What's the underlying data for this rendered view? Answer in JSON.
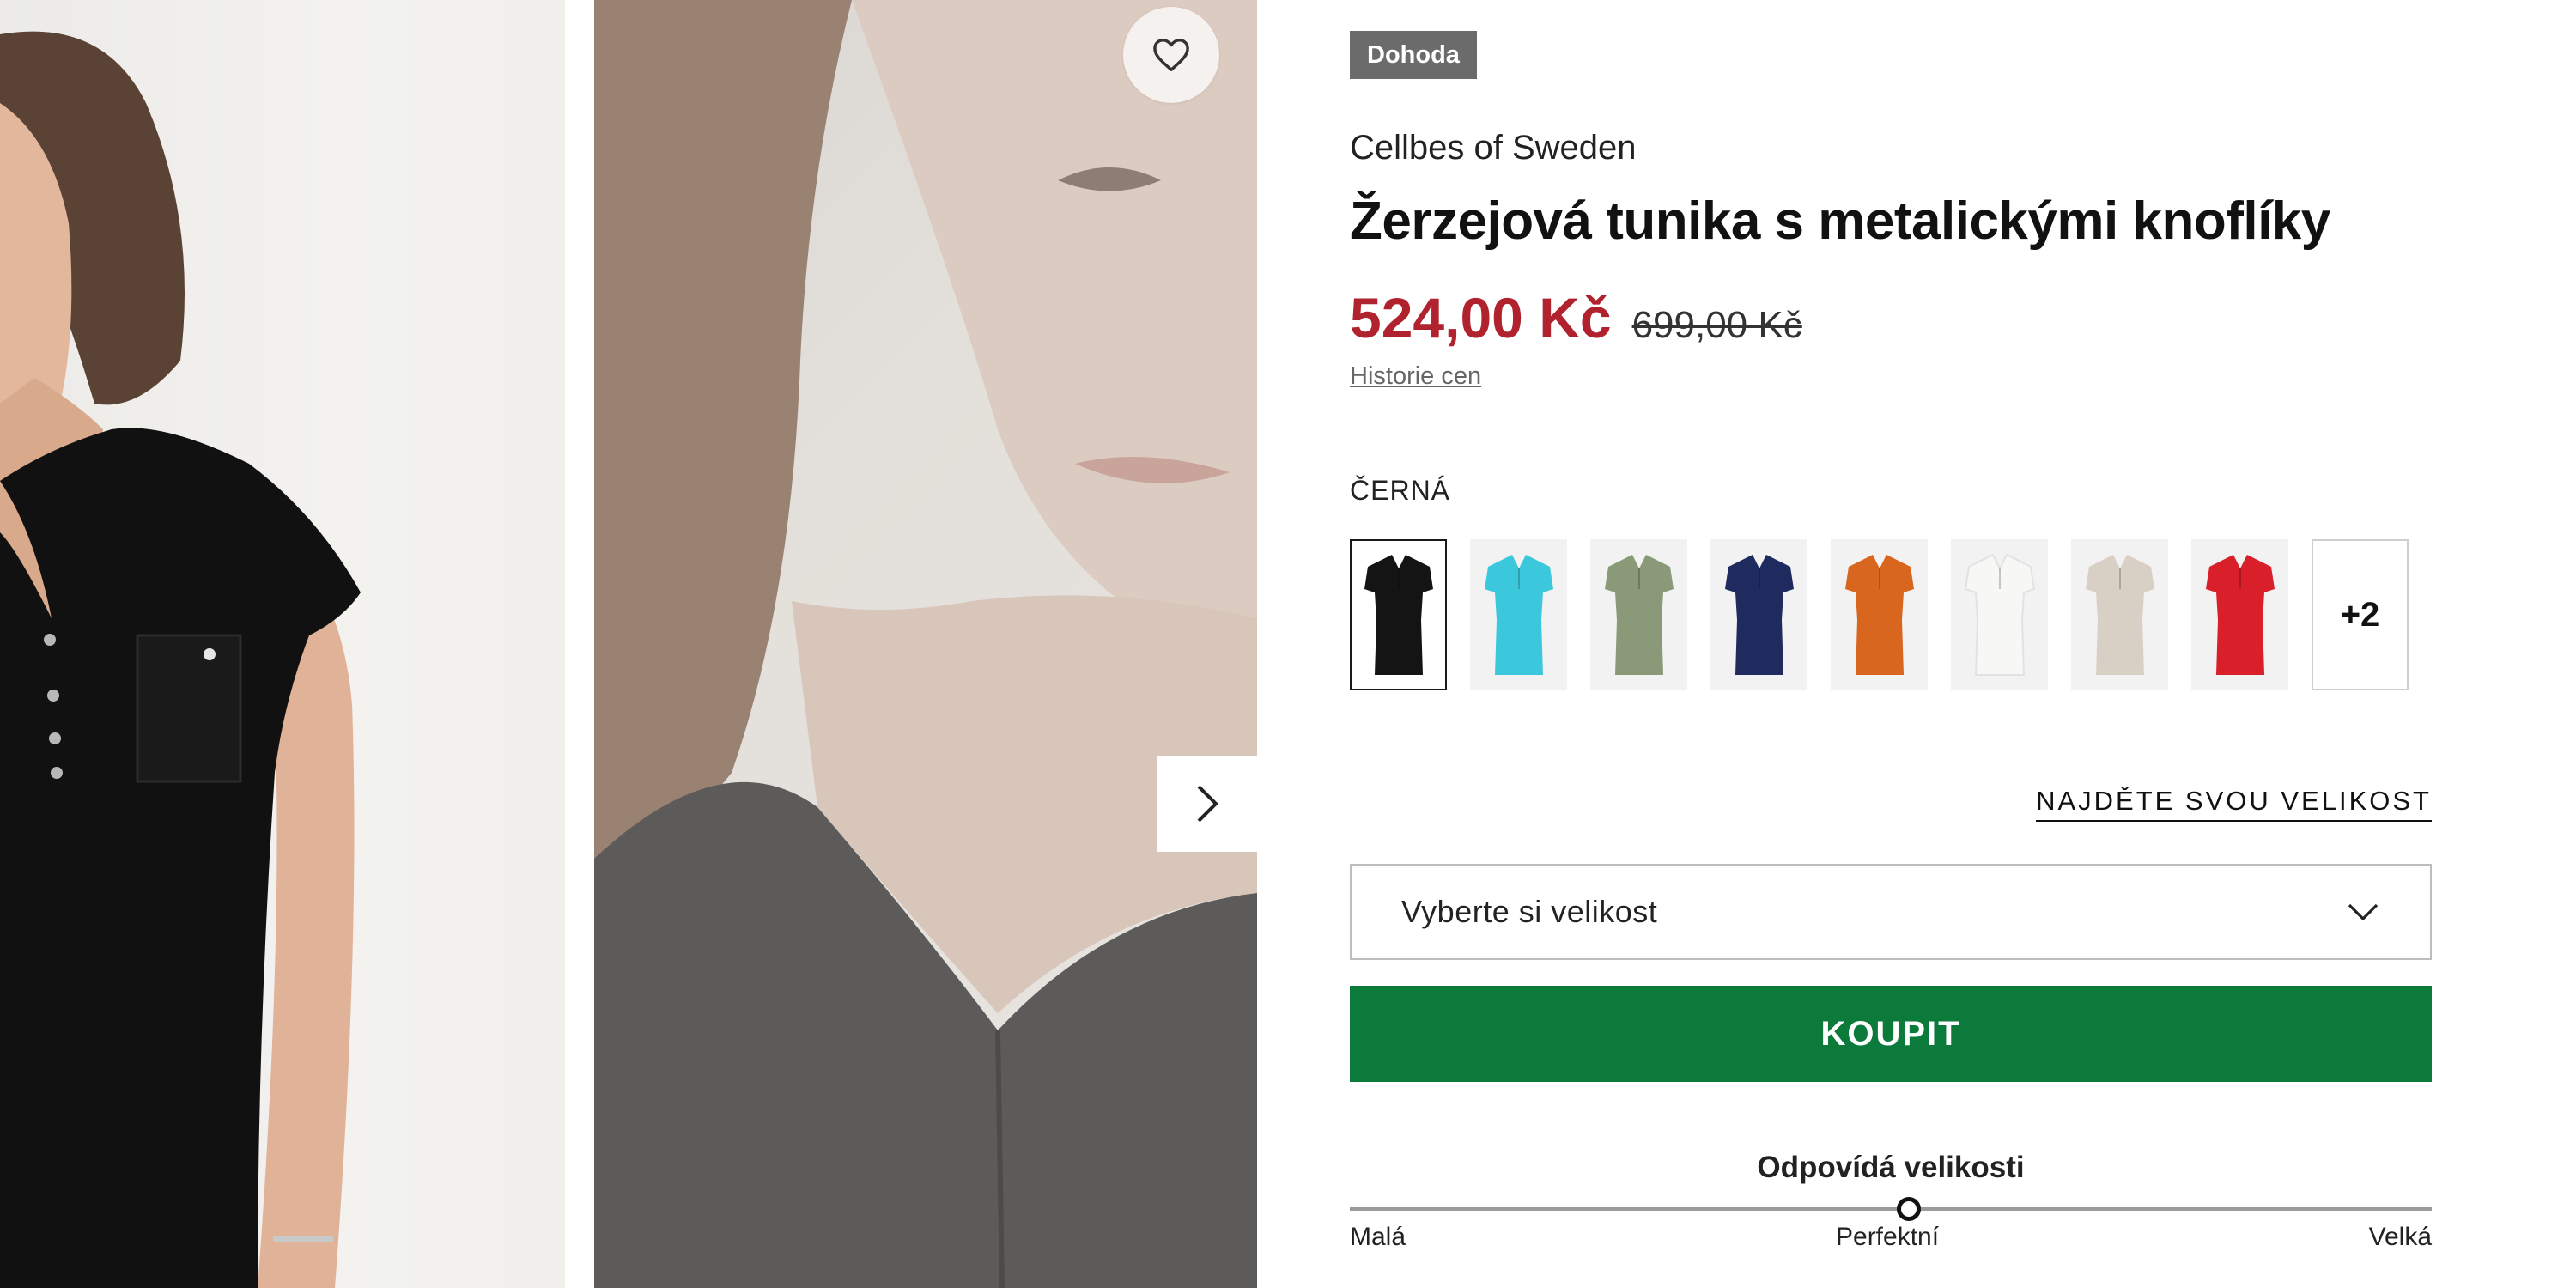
{
  "product": {
    "badge": "Dohoda",
    "brand": "Cellbes of Sweden",
    "title": "Žerzejová tunika s metalickými knoflíky",
    "price": "524,00 Kč",
    "old_price": "699,00 Kč",
    "price_history_link": "Historie cen",
    "price_color": "#b0222e"
  },
  "color": {
    "selected_name": "ČERNÁ",
    "swatches": [
      {
        "name": "black",
        "hex": "#141414",
        "selected": true
      },
      {
        "name": "turquoise",
        "hex": "#3cc8dc",
        "selected": false
      },
      {
        "name": "khaki",
        "hex": "#8a9a78",
        "selected": false
      },
      {
        "name": "navy",
        "hex": "#1f2a5e",
        "selected": false
      },
      {
        "name": "orange",
        "hex": "#d9661f",
        "selected": false
      },
      {
        "name": "white",
        "hex": "#f7f7f5",
        "selected": false
      },
      {
        "name": "beige",
        "hex": "#d8d0c4",
        "selected": false
      },
      {
        "name": "red",
        "hex": "#d81f2a",
        "selected": false
      }
    ],
    "more_label": "+2"
  },
  "size": {
    "find_size_link": "NAJDĚTE SVOU VELIKOST",
    "select_placeholder": "Vyberte si velikost"
  },
  "buy_button": {
    "label": "KOUPIT",
    "color": "#0b7a3a"
  },
  "fit": {
    "title": "Odpovídá velikosti",
    "labels": [
      "Malá",
      "Perfektní",
      "Velká"
    ],
    "value_fraction": 0.517
  },
  "gallery": {
    "wishlist_icon": "heart-outline-icon",
    "next_icon": "chevron-right-icon"
  }
}
